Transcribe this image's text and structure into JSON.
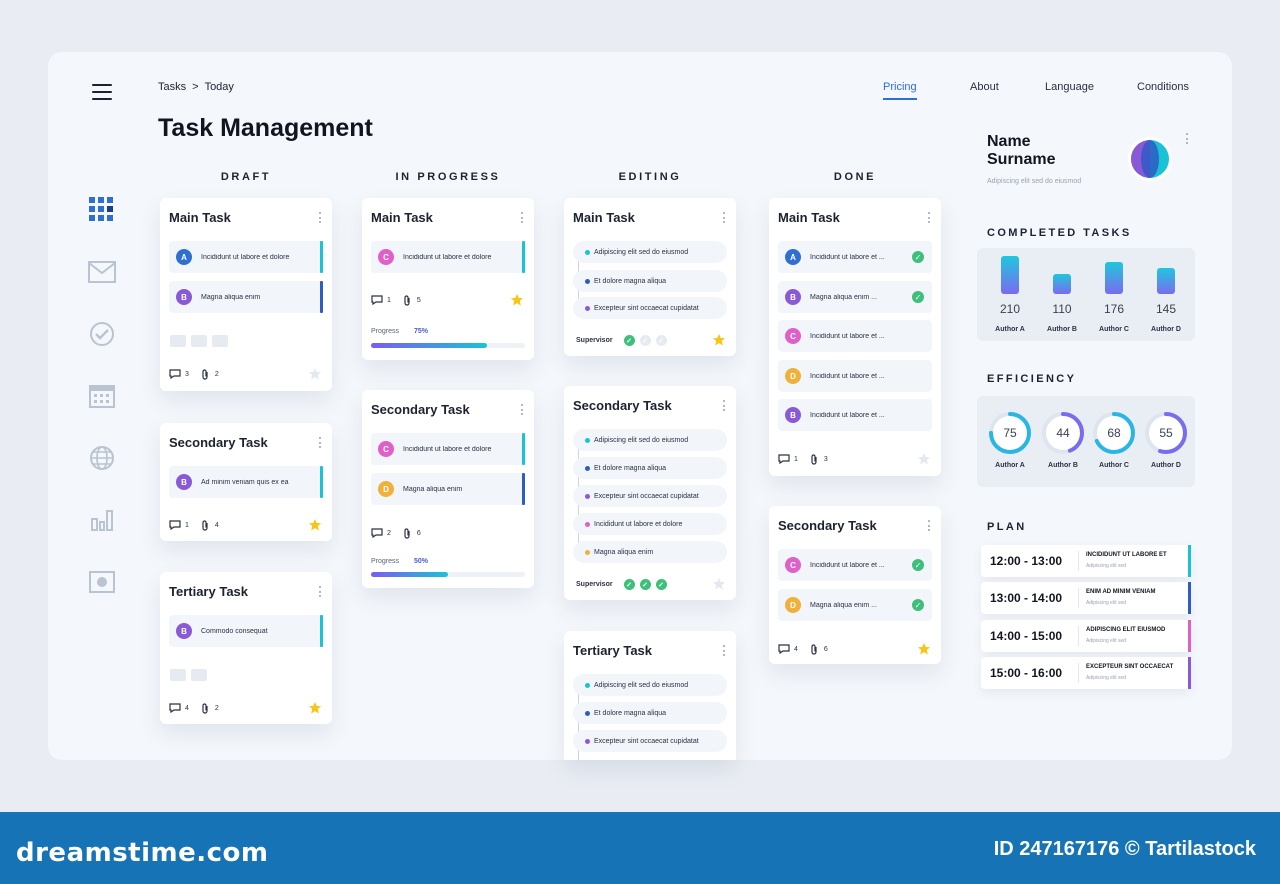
{
  "nav": {
    "breadcrumb_root": "Tasks",
    "breadcrumb_sep": ">",
    "breadcrumb_current": "Today",
    "links": [
      "Pricing",
      "About",
      "Language",
      "Conditions"
    ]
  },
  "page_title": "Task Management",
  "columns": [
    "DRAFT",
    "IN PROGRESS",
    "EDITING",
    "DONE"
  ],
  "avatar_colors": {
    "A": "#2f6fd1",
    "B": "#8a5ad6",
    "C": "#e060c9",
    "D": "#f0b13a"
  },
  "accent_colors": {
    "teal": "#19c3d6",
    "blue": "#2f5bc4",
    "pink": "#e060c9",
    "purple": "#8a5ad6",
    "green": "#3cc07a",
    "star": "#f5c518"
  },
  "draft": {
    "main": {
      "title": "Main Task",
      "items": [
        {
          "avatar": "A",
          "text": "Incididunt ut labore et dolore"
        },
        {
          "avatar": "B",
          "text": "Magna aliqua enim"
        }
      ],
      "comments": "3",
      "attachments": "2"
    },
    "secondary": {
      "title": "Secondary Task",
      "items": [
        {
          "avatar": "B",
          "text": "Ad minim veniam  quis ex ea"
        }
      ],
      "comments": "1",
      "attachments": "4"
    },
    "tertiary": {
      "title": "Tertiary Task",
      "items": [
        {
          "avatar": "B",
          "text": "Commodo consequat"
        }
      ],
      "comments": "4",
      "attachments": "2"
    }
  },
  "in_progress": {
    "main": {
      "title": "Main Task",
      "items": [
        {
          "avatar": "C",
          "text": "Incididunt ut labore et dolore"
        }
      ],
      "comments": "1",
      "attachments": "5",
      "progress_label": "Progress",
      "progress_value": "75%",
      "progress": 0.75
    },
    "secondary": {
      "title": "Secondary Task",
      "items": [
        {
          "avatar": "C",
          "text": "Incididunt ut labore et dolore"
        },
        {
          "avatar": "D",
          "text": "Magna aliqua enim"
        }
      ],
      "comments": "2",
      "attachments": "6",
      "progress_label": "Progress",
      "progress_value": "50%",
      "progress": 0.5
    }
  },
  "editing": {
    "main": {
      "title": "Main Task",
      "items": [
        "Adipiscing elit sed do eiusmod",
        "Et dolore magna aliqua",
        "Excepteur sint occaecat cupidatat"
      ],
      "supervisor": "Supervisor"
    },
    "secondary": {
      "title": "Secondary Task",
      "items": [
        "Adipiscing elit sed do eiusmod",
        "Et dolore magna aliqua",
        "Excepteur sint occaecat cupidatat",
        "Incididunt ut labore et dolore",
        "Magna aliqua enim"
      ],
      "supervisor": "Supervisor"
    },
    "tertiary": {
      "title": "Tertiary Task",
      "items": [
        "Adipiscing elit sed do eiusmod",
        "Et dolore magna aliqua",
        "Excepteur sint occaecat cupidatat"
      ]
    }
  },
  "done": {
    "main": {
      "title": "Main Task",
      "items": [
        {
          "avatar": "A",
          "text": "Incididunt ut labore et ..."
        },
        {
          "avatar": "B",
          "text": "Magna aliqua enim ..."
        },
        {
          "avatar": "C",
          "text": "Incididunt ut labore et ..."
        },
        {
          "avatar": "D",
          "text": "Incididunt ut labore et ..."
        },
        {
          "avatar": "B",
          "text": "Incididunt ut labore et ..."
        }
      ],
      "comments": "1",
      "attachments": "3"
    },
    "secondary": {
      "title": "Secondary Task",
      "items": [
        {
          "avatar": "C",
          "text": "Incididunt ut labore et ..."
        },
        {
          "avatar": "D",
          "text": "Magna aliqua enim ..."
        }
      ],
      "comments": "4",
      "attachments": "6"
    }
  },
  "profile": {
    "name_line1": "Name",
    "name_line2": "Surname",
    "subtitle": "Adipiscing elit sed do eiusmod"
  },
  "completed_tasks": {
    "heading": "COMPLETED TASKS",
    "authors": [
      "Author A",
      "Author B",
      "Author C",
      "Author D"
    ],
    "values": [
      210,
      110,
      176,
      145
    ]
  },
  "efficiency": {
    "heading": "EFFICIENCY",
    "authors": [
      "Author A",
      "Author B",
      "Author C",
      "Author D"
    ],
    "values": [
      75,
      44,
      68,
      55
    ]
  },
  "plan": {
    "heading": "PLAN",
    "rows": [
      {
        "time": "12:00 - 13:00",
        "title": "INCIDIDUNT UT LABORE ET",
        "sub": "Adipiscing elit sed",
        "color": "#19c3d6"
      },
      {
        "time": "13:00 - 14:00",
        "title": "ENIM AD MINIM VENIAM",
        "sub": "Adipiscing elit sed",
        "color": "#2f5bc4"
      },
      {
        "time": "14:00 - 15:00",
        "title": "ADIPISCING ELIT EIUSMOD",
        "sub": "Adipiscing elit sed",
        "color": "#e060c9"
      },
      {
        "time": "15:00 - 16:00",
        "title": "EXCEPTEUR SINT OCCAECAT",
        "sub": "Adipiscing elit sed",
        "color": "#8a5ad6"
      }
    ]
  },
  "footer": {
    "brand": "dreamstime.com",
    "id_text": "ID 247167176 © Tartilastock"
  }
}
